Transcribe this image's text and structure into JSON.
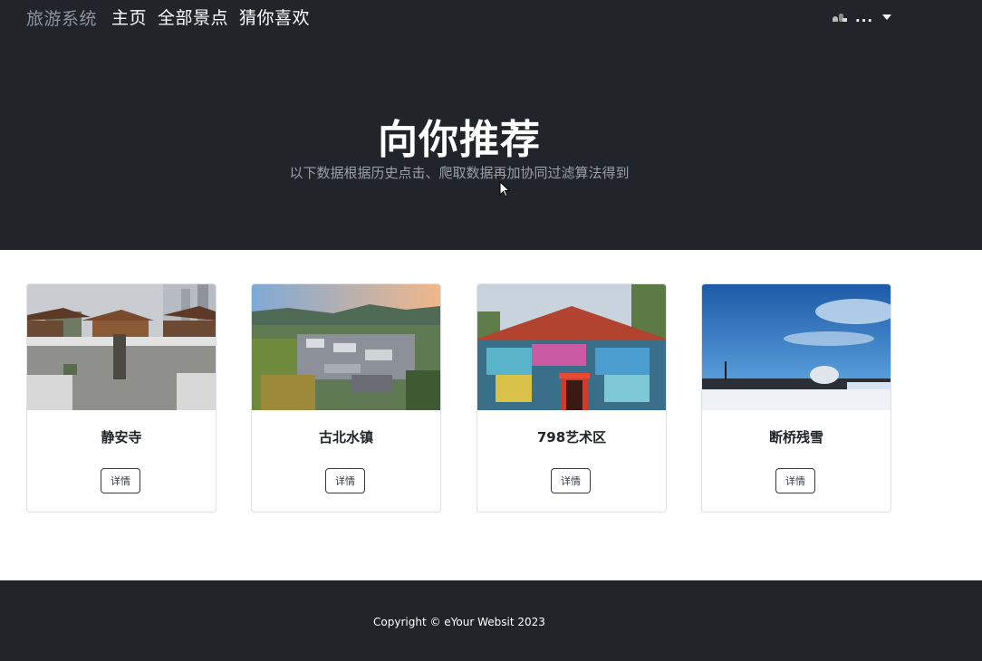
{
  "nav": {
    "brand": "旅游系统",
    "links": [
      "主页",
      "全部景点",
      "猜你喜欢"
    ],
    "user_name": "..."
  },
  "hero": {
    "title": "向你推荐",
    "subtitle": "以下数据根据历史点击、爬取数据再加协同过滤算法得到"
  },
  "cards": [
    {
      "title": "静安寺",
      "button": "详情",
      "image": "temple-photo"
    },
    {
      "title": "古北水镇",
      "button": "详情",
      "image": "water-town-photo"
    },
    {
      "title": "798艺术区",
      "button": "详情",
      "image": "graffiti-art-photo"
    },
    {
      "title": "断桥残雪",
      "button": "详情",
      "image": "snow-bridge-photo"
    }
  ],
  "footer": {
    "text": "Copyright © eYour Websit 2023"
  },
  "colors": {
    "dark": "#212529",
    "muted": "#8f949a",
    "white": "#ffffff"
  }
}
